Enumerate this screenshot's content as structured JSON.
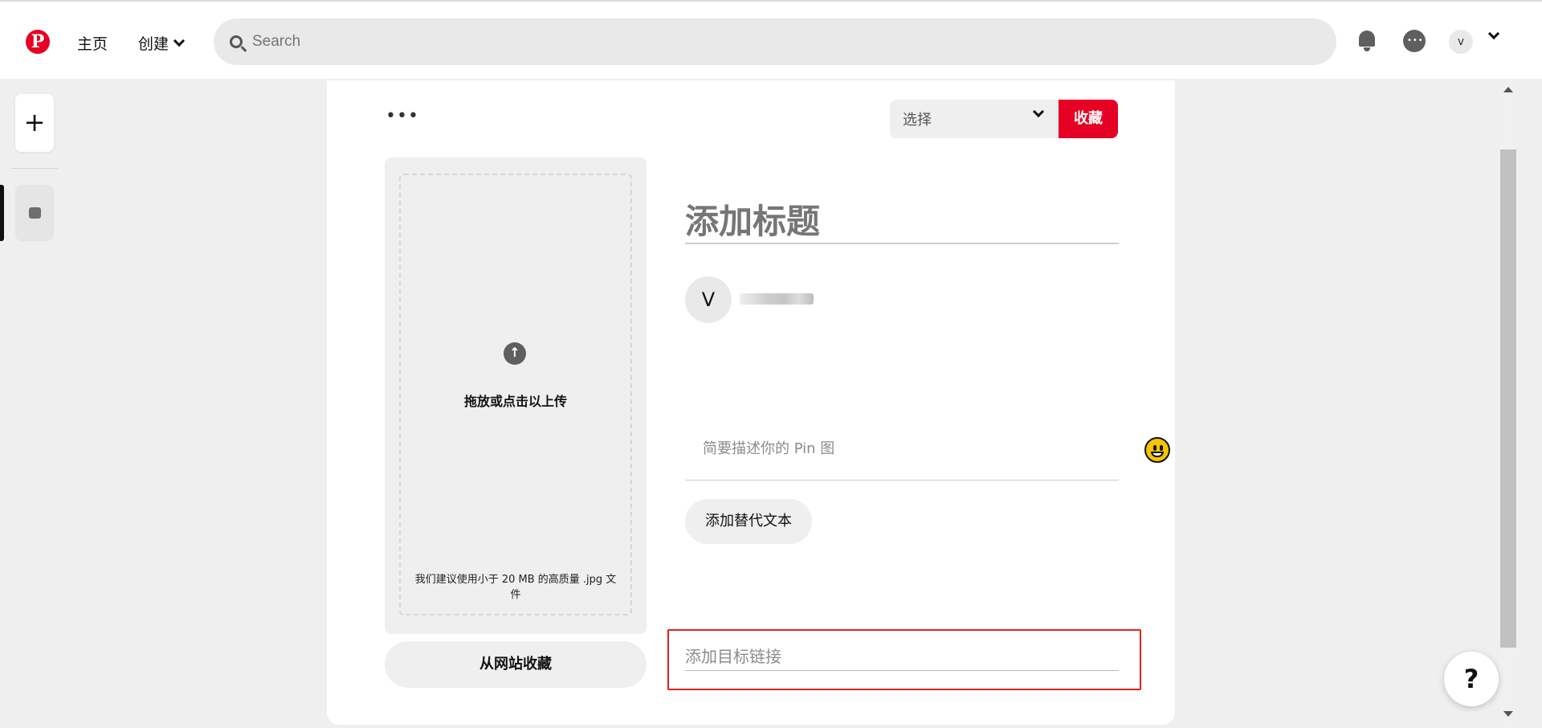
{
  "header": {
    "logo": "P",
    "nav_home": "主页",
    "nav_create": "创建",
    "search_placeholder": "Search",
    "account_initial": "v"
  },
  "card": {
    "more_menu": "•••",
    "board_select": "选择",
    "save_button": "收藏",
    "upload_icon": "↑",
    "upload_label": "拖放或点击以上传",
    "upload_hint": "我们建议使用小于 20 MB 的高质量 .jpg 文件",
    "from_web_button": "从网站收藏",
    "title_placeholder": "添加标题",
    "author_initial": "V",
    "description_placeholder": "简要描述你的 Pin 图",
    "alt_text_button": "添加替代文本",
    "link_placeholder": "添加目标链接"
  },
  "help": "?",
  "colors": {
    "brand": "#e60023",
    "highlight_border": "#e02020"
  }
}
